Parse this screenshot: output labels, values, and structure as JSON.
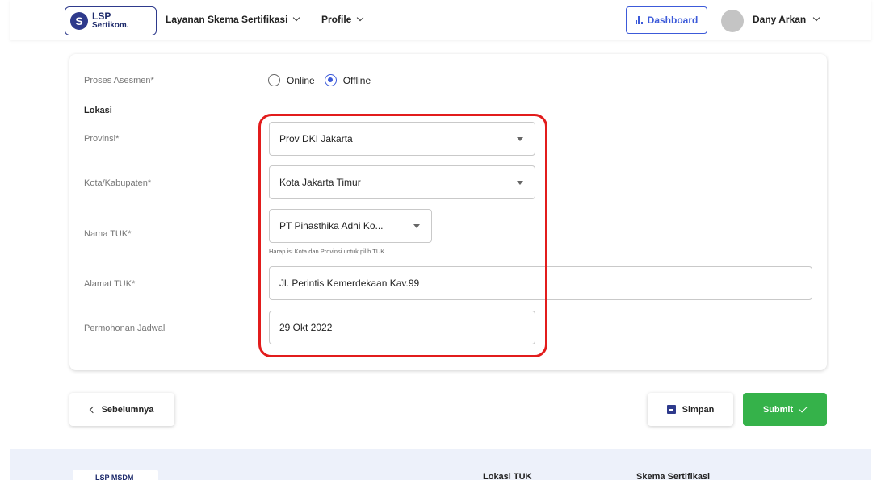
{
  "header": {
    "logo": {
      "line1": "LSP",
      "line2": "Sertikom."
    },
    "nav": [
      {
        "label": "Layanan Skema Sertifikasi"
      },
      {
        "label": "Profile"
      }
    ],
    "dashboard_label": "Dashboard",
    "user_name": "Dany Arkan"
  },
  "form": {
    "proses_label": "Proses Asesmen*",
    "proses_options": [
      "Online",
      "Offline"
    ],
    "proses_selected": "Offline",
    "lokasi_heading": "Lokasi",
    "provinsi": {
      "label": "Provinsi*",
      "value": "Prov DKI Jakarta"
    },
    "kota": {
      "label": "Kota/Kabupaten*",
      "value": "Kota Jakarta Timur"
    },
    "tuk": {
      "label": "Nama TUK*",
      "value": "PT Pinasthika Adhi Ko...",
      "helper": "Harap isi Kota dan Provinsi untuk pilih TUK"
    },
    "alamat": {
      "label": "Alamat TUK*",
      "value": "Jl. Perintis Kemerdekaan Kav.99"
    },
    "jadwal": {
      "label": "Permohonan Jadwal",
      "value": "29 Okt 2022"
    }
  },
  "actions": {
    "prev_label": "Sebelumnya",
    "save_label": "Simpan",
    "submit_label": "Submit"
  },
  "footer": {
    "logo_text": "LSP MSDM",
    "col1_heading": "Lokasi TUK",
    "col2_heading": "Skema Sertifikasi"
  },
  "colors": {
    "accent": "#3c5ad9",
    "submit": "#35b24a",
    "highlight": "#e21c1c"
  }
}
